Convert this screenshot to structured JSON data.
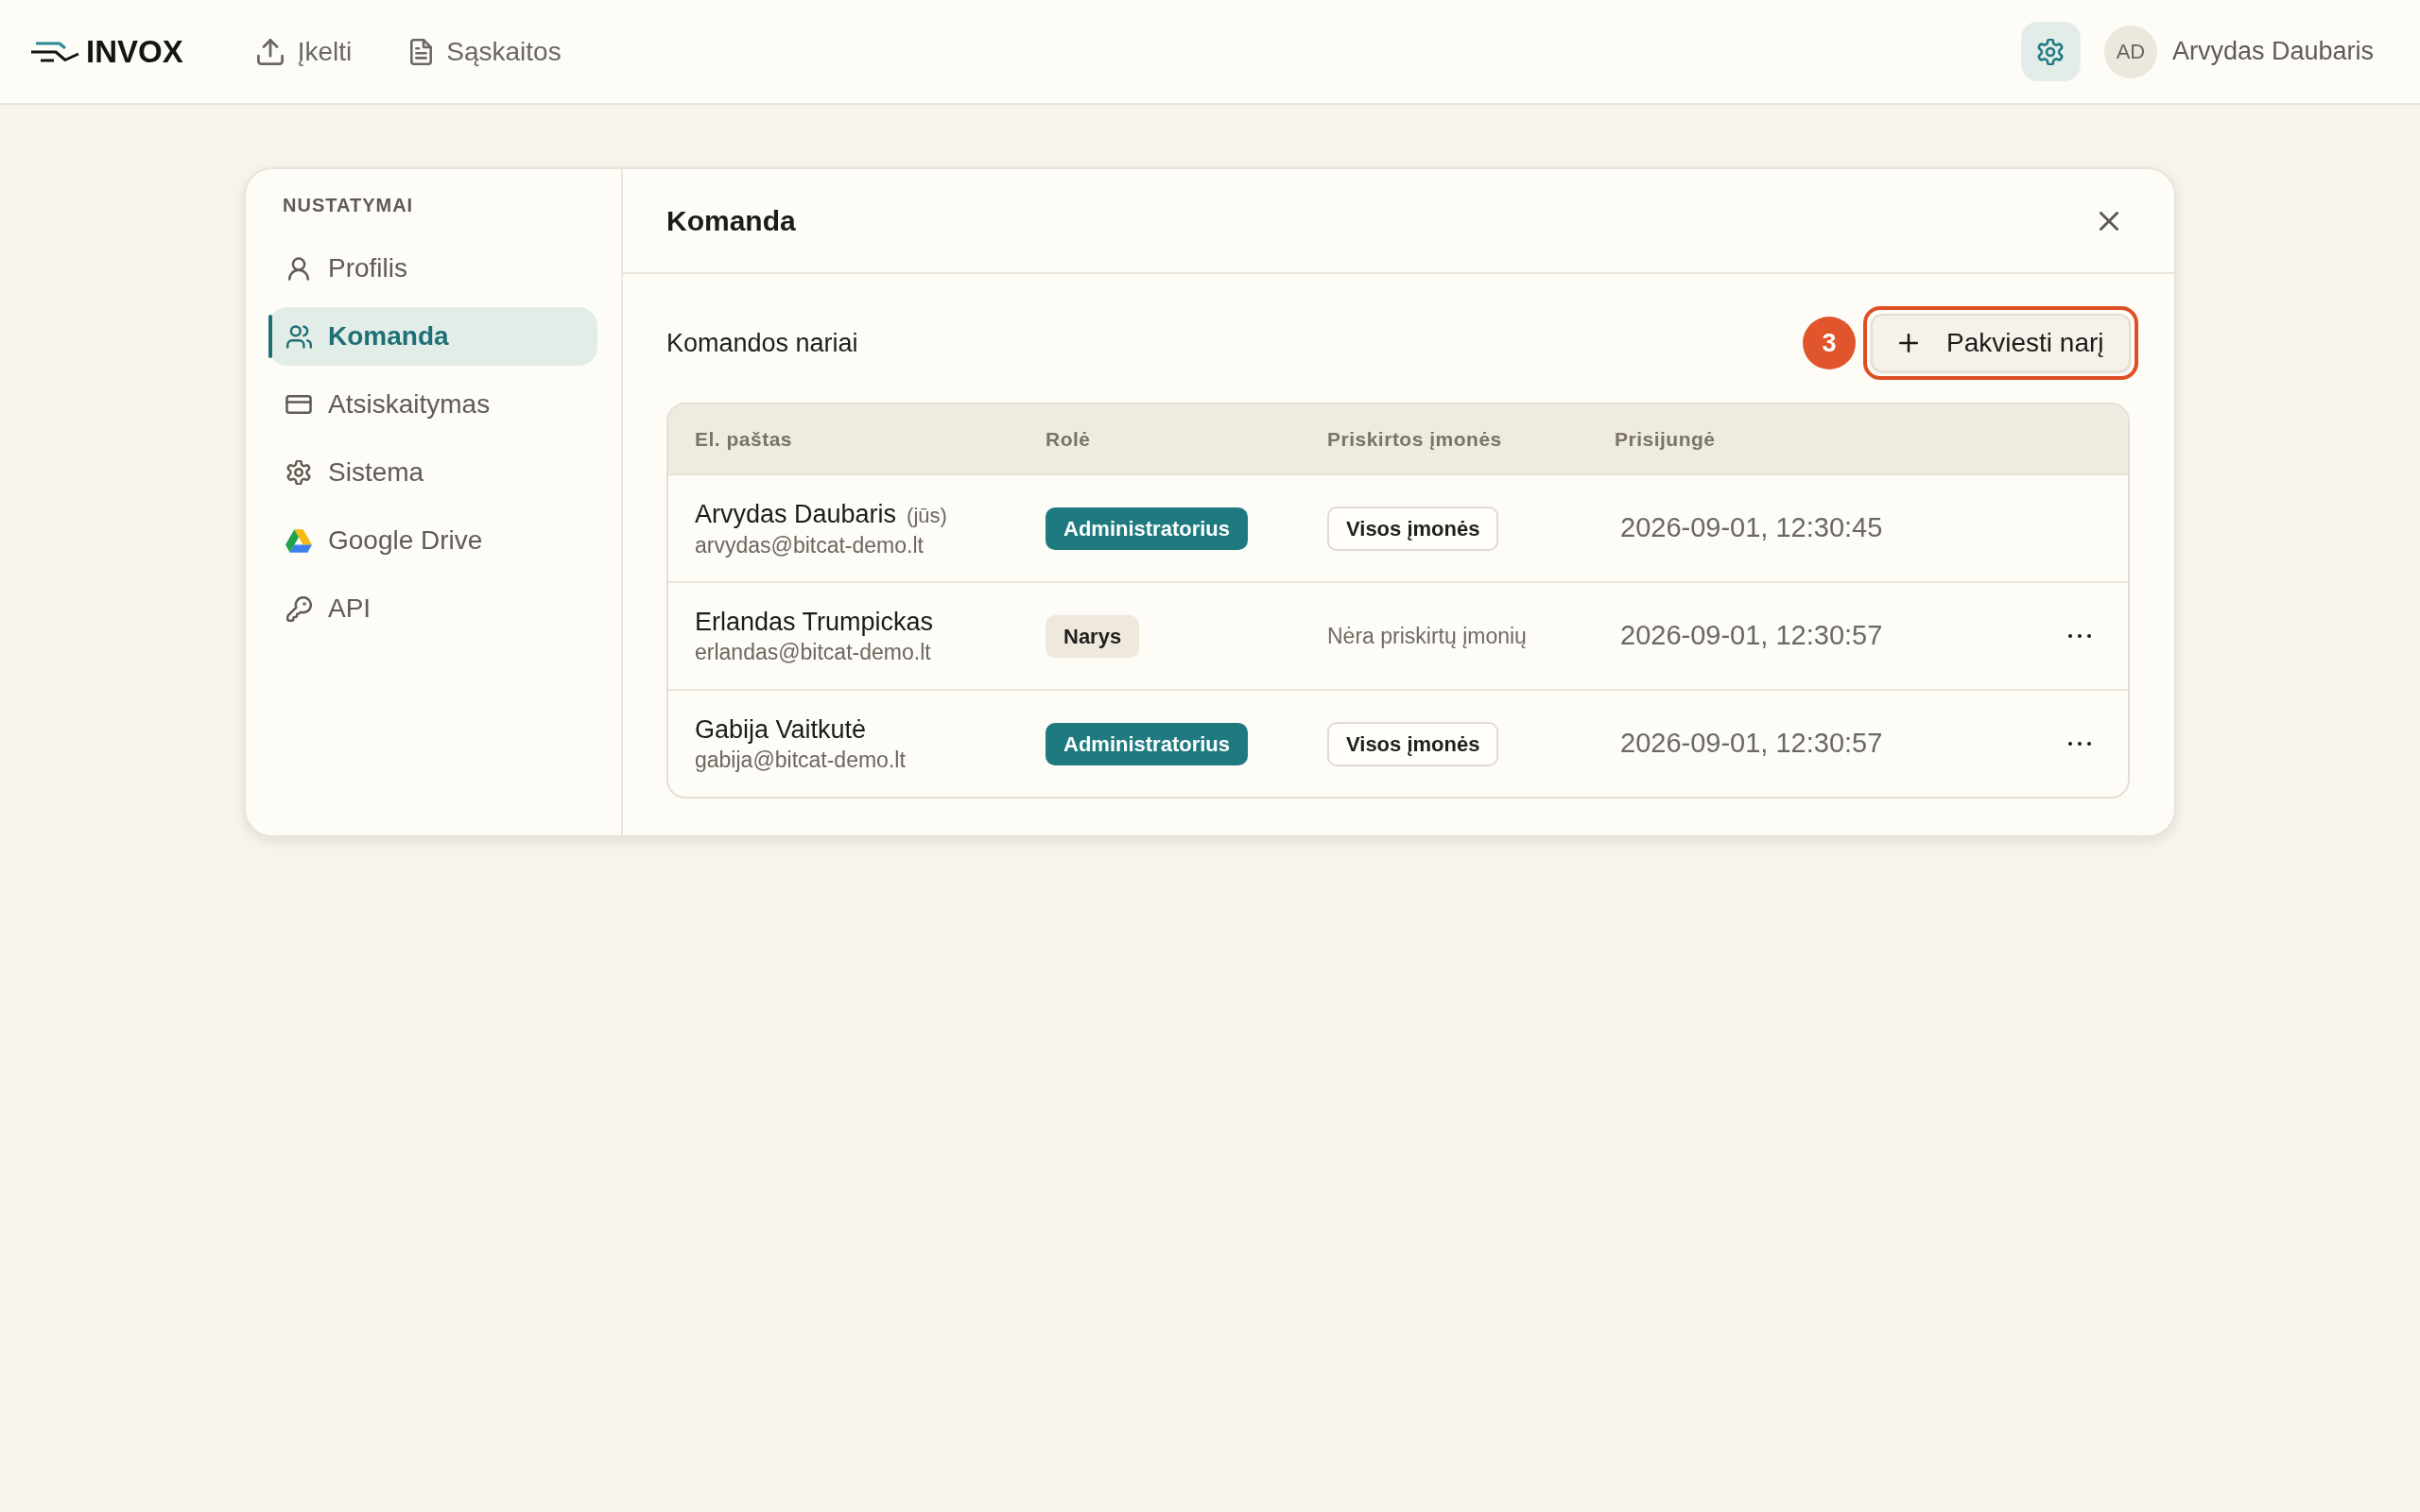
{
  "topbar": {
    "logo": "INVOX",
    "nav": [
      {
        "label": "Įkelti",
        "selected": false
      },
      {
        "label": "Sąskaitos",
        "selected": false
      }
    ],
    "settings": {
      "selected": true
    },
    "user": {
      "initials": "AD",
      "name": "Arvydas Daubaris"
    }
  },
  "sidebar": {
    "heading": "NUSTATYMAI",
    "items": [
      {
        "label": "Profilis",
        "selected": false
      },
      {
        "label": "Komanda",
        "selected": true
      },
      {
        "label": "Atsiskaitymas",
        "selected": false
      },
      {
        "label": "Sistema",
        "selected": false
      },
      {
        "label": "Google Drive",
        "selected": false
      },
      {
        "label": "API",
        "selected": false
      }
    ]
  },
  "panel": {
    "title": "Komanda",
    "section_title": "Komandos nariai",
    "step_badge": "3",
    "invite_button": {
      "label": "Pakviesti narį",
      "highlighted": true
    },
    "table": {
      "columns": [
        "El. paštas",
        "Rolė",
        "Priskirtos įmonės",
        "Prisijungė"
      ],
      "rows": [
        {
          "name": "Arvydas Daubaris",
          "note": "(jūs)",
          "email": "arvydas@bitcat-demo.lt",
          "role": {
            "label": "Administratorius",
            "kind": "admin"
          },
          "companies": {
            "label": "Visos įmonės",
            "kind": "tag"
          },
          "joined": "2026-09-01, 12:30:45",
          "menu": false
        },
        {
          "name": "Erlandas Trumpickas",
          "email": "erlandas@bitcat-demo.lt",
          "role": {
            "label": "Narys",
            "kind": "member"
          },
          "companies": {
            "label": "Nėra priskirtų įmonių",
            "kind": "text"
          },
          "joined": "2026-09-01, 12:30:57",
          "menu": true
        },
        {
          "name": "Gabija Vaitkutė",
          "email": "gabija@bitcat-demo.lt",
          "role": {
            "label": "Administratorius",
            "kind": "admin"
          },
          "companies": {
            "label": "Visos įmonės",
            "kind": "tag"
          },
          "joined": "2026-09-01, 12:30:57",
          "menu": true
        }
      ]
    }
  }
}
